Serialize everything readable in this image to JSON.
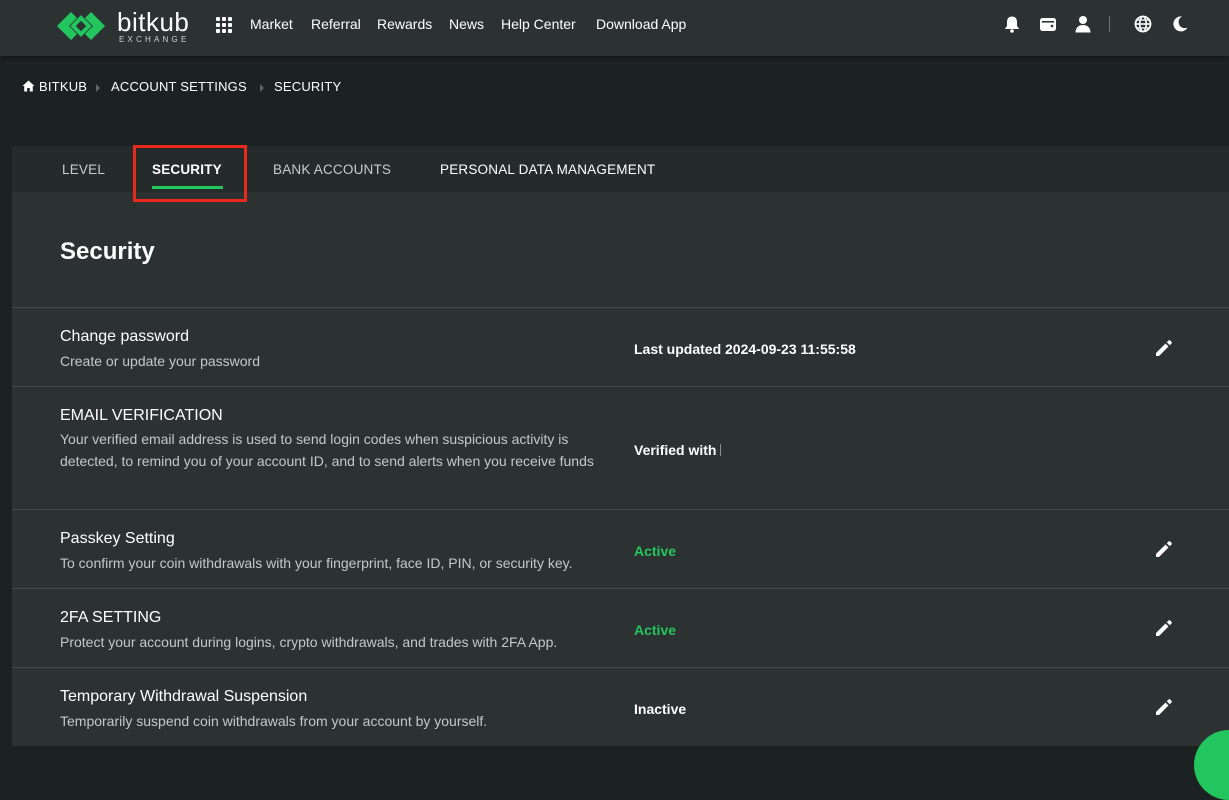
{
  "brand": {
    "name": "bitkub",
    "subtitle": "EXCHANGE",
    "accent_color": "#22c55e"
  },
  "nav": {
    "apps_icon": "grid-icon",
    "links": [
      "Market",
      "Referral",
      "Rewards",
      "News",
      "Help Center",
      "Download App"
    ],
    "icons": [
      "bell-icon",
      "wallet-icon",
      "user-icon",
      "globe-icon",
      "moon-icon"
    ]
  },
  "breadcrumb": {
    "home_icon": "home-icon",
    "items": [
      "BITKUB",
      "ACCOUNT SETTINGS",
      "SECURITY"
    ]
  },
  "tabs": {
    "items": [
      "LEVEL",
      "SECURITY",
      "BANK ACCOUNTS",
      "PERSONAL DATA MANAGEMENT"
    ],
    "active": "SECURITY",
    "highlight_color": "#e8291c"
  },
  "section": {
    "title": "Security"
  },
  "rows": [
    {
      "title": "Change password",
      "description": "Create or update your password",
      "status": "Last updated 2024-09-23 11:55:58",
      "editable": true
    },
    {
      "title": "EMAIL VERIFICATION",
      "description": "Your verified email address is used to send login codes when suspicious activity is detected, to remind you of your account ID, and to send alerts when you receive funds",
      "status": "Verified with",
      "editable": false
    },
    {
      "title": "Passkey Setting",
      "description": "To confirm your coin withdrawals with your fingerprint, face ID, PIN, or security key.",
      "status": "Active",
      "editable": true
    },
    {
      "title": "2FA SETTING",
      "description": "Protect your account during logins, crypto withdrawals, and trades with 2FA App.",
      "status": "Active",
      "editable": true
    },
    {
      "title": "Temporary Withdrawal Suspension",
      "description": "Temporarily suspend coin withdrawals from your account by yourself.",
      "status": "Inactive",
      "editable": true
    }
  ]
}
